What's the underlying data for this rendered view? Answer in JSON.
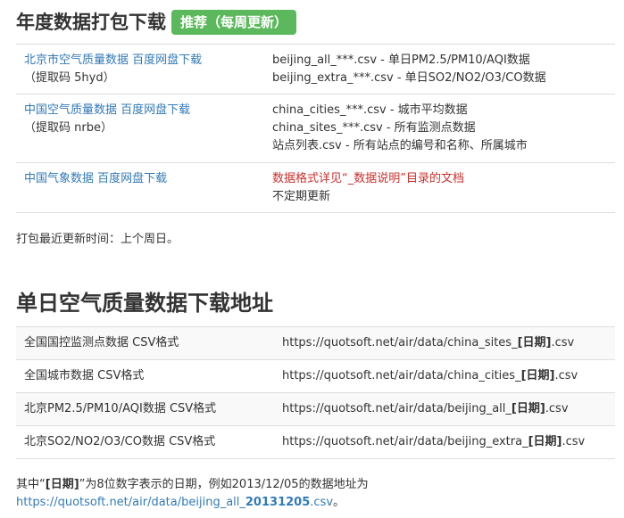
{
  "section1": {
    "title": "年度数据打包下载",
    "badge": "推荐（每周更新）",
    "rows": [
      {
        "link": "北京市空气质量数据 百度网盘下载",
        "code": "（提取码 5hyd）",
        "lines": [
          "beijing_all_***.csv - 单日PM2.5/PM10/AQI数据",
          "beijing_extra_***.csv - 单日SO2/NO2/O3/CO数据"
        ]
      },
      {
        "link": "中国空气质量数据 百度网盘下载",
        "code": "（提取码 nrbe）",
        "lines": [
          "china_cities_***.csv - 城市平均数据",
          "china_sites_***.csv - 所有监测点数据",
          "站点列表.csv - 所有站点的编号和名称、所属城市"
        ]
      },
      {
        "link": "中国气象数据 百度网盘下载",
        "red": "数据格式详见“_数据说明”目录的文档",
        "lines": [
          "不定期更新"
        ]
      }
    ],
    "update_note": "打包最近更新时间：上个周日。"
  },
  "section2": {
    "title": "单日空气质量数据下载地址",
    "rows": [
      {
        "label": "全国国控监测点数据 CSV格式",
        "url_prefix": "https://quotsoft.net/air/data/china_sites_",
        "placeholder": "[日期]",
        "ext": ".csv"
      },
      {
        "label": "全国城市数据 CSV格式",
        "url_prefix": "https://quotsoft.net/air/data/china_cities_",
        "placeholder": "[日期]",
        "ext": ".csv"
      },
      {
        "label": "北京PM2.5/PM10/AQI数据 CSV格式",
        "url_prefix": "https://quotsoft.net/air/data/beijing_all_",
        "placeholder": "[日期]",
        "ext": ".csv"
      },
      {
        "label": "北京SO2/NO2/O3/CO数据 CSV格式",
        "url_prefix": "https://quotsoft.net/air/data/beijing_extra_",
        "placeholder": "[日期]",
        "ext": ".csv"
      }
    ],
    "footer": {
      "pre": "其中“",
      "bold": "[日期]",
      "post": "”为8位数字表示的日期，例如2013/12/05的数据地址为",
      "link_prefix": "https://quotsoft.net/air/data/beijing_all_",
      "link_date": "20131205",
      "link_ext": ".csv",
      "end": "。"
    }
  }
}
